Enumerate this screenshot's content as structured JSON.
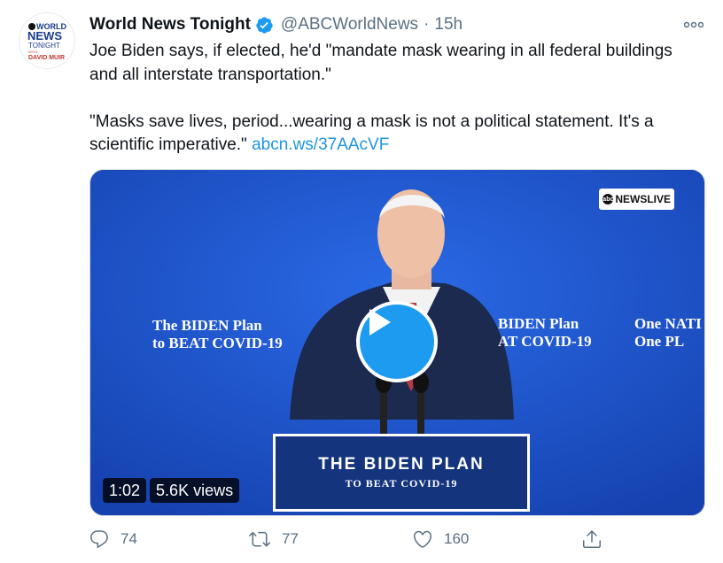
{
  "tweet": {
    "author": {
      "display_name": "World News Tonight",
      "handle": "@ABCWorldNews",
      "verified": true,
      "avatar_lines": [
        "WORLD",
        "NEWS",
        "TONIGHT",
        "WITH",
        "DAVID MUIR"
      ]
    },
    "separator": "·",
    "time": "15h",
    "text_paragraph_1": "Joe Biden says, if elected, he'd \"mandate mask wearing in all federal buildings and all interstate transportation.\"",
    "text_paragraph_2": "\"Masks save lives, period...wearing a mask is not a political statement. It's a scientific imperative.\" ",
    "link_text": "abcn.ws/37AAcVF",
    "more_icon": "ellipsis-icon"
  },
  "media": {
    "type": "video",
    "broadcast_badge": "NEWSLIVE",
    "backdrop_left_line1": "The BIDEN Plan",
    "backdrop_left_line2": "to BEAT COVID-19",
    "backdrop_mid_line1": "BIDEN Plan",
    "backdrop_mid_line2": "AT COVID-19",
    "backdrop_right_line1": "One NATI",
    "backdrop_right_line2": "One PL",
    "podium_title": "THE BIDEN PLAN",
    "podium_subtitle": "TO BEAT COVID-19",
    "duration": "1:02",
    "views": "5.6K views",
    "play_icon": "play-icon",
    "colors": {
      "backdrop": "#1f55c6",
      "podium": "#14347e",
      "play_button": "#1d9bf0"
    }
  },
  "actions": {
    "reply_count": "74",
    "retweet_count": "77",
    "like_count": "160",
    "icons": [
      "reply-icon",
      "retweet-icon",
      "like-icon",
      "share-icon"
    ]
  },
  "colors": {
    "link": "#1b95e0",
    "secondary_text": "#5b7083",
    "verified": "#1d9bf0"
  }
}
